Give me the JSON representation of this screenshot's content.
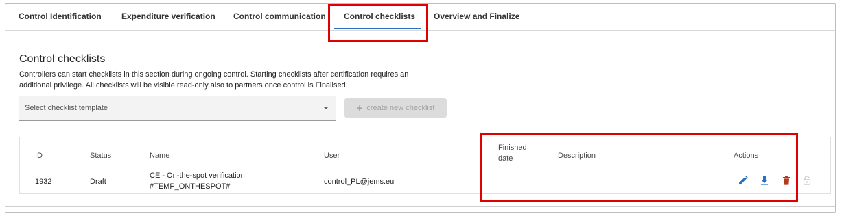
{
  "tabs": [
    {
      "label": "Control Identification"
    },
    {
      "label": "Expenditure verification"
    },
    {
      "label": "Control communication"
    },
    {
      "label": "Control checklists"
    },
    {
      "label": "Overview and Finalize"
    }
  ],
  "section": {
    "title": "Control checklists",
    "description": "Controllers can start checklists in this section during ongoing control. Starting checklists after certification requires an additional privilege. All checklists will be visible read-only also to partners once control is Finalised."
  },
  "template_select": {
    "placeholder": "Select checklist template"
  },
  "create_button": {
    "label": "create new checklist"
  },
  "table": {
    "headers": {
      "id": "ID",
      "status": "Status",
      "name": "Name",
      "user": "User",
      "finished_line1": "Finished",
      "finished_line2": "date",
      "description": "Description",
      "actions": "Actions"
    },
    "rows": [
      {
        "id": "1932",
        "status": "Draft",
        "name_line1": "CE - On-the-spot verification",
        "name_line2": "#TEMP_ONTHESPOT#",
        "user": "control_PL@jems.eu",
        "finished_date": "",
        "description": ""
      }
    ]
  },
  "colors": {
    "accent": "#2a6fb8",
    "delete": "#b5391b",
    "highlight": "#e00000",
    "disabled": "#c4c4c4"
  },
  "icons": [
    "edit-icon",
    "download-icon",
    "delete-icon",
    "lock-open-icon"
  ]
}
